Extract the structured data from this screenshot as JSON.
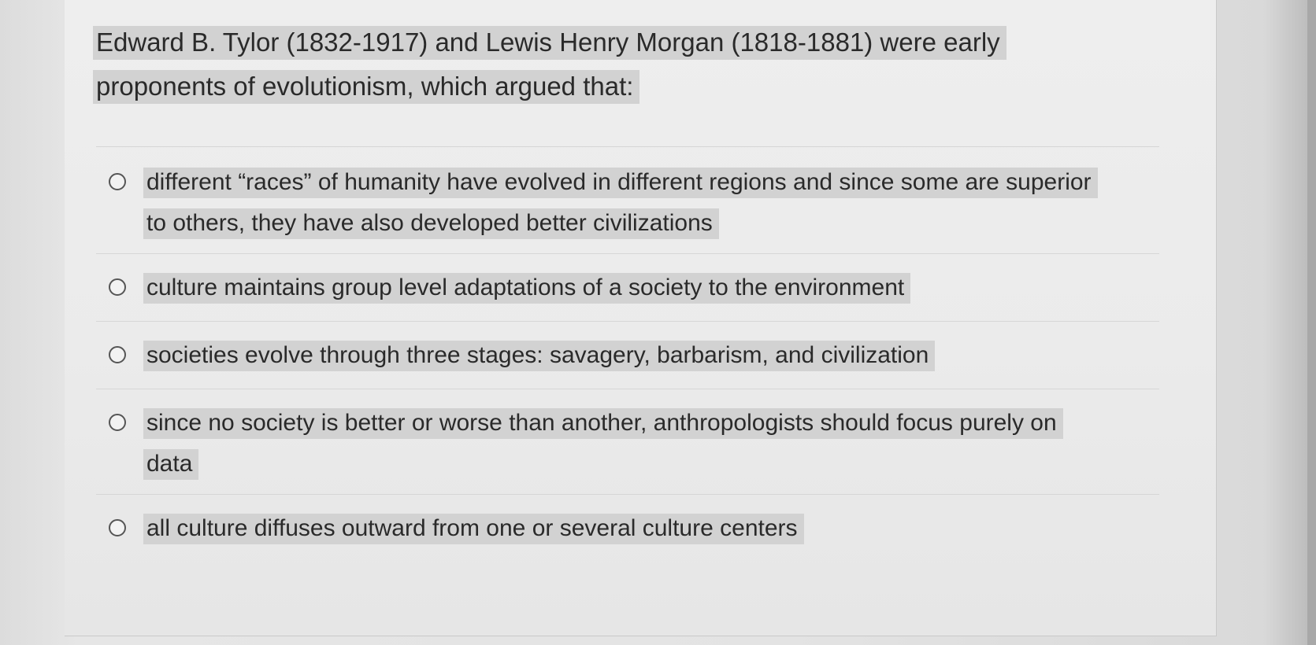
{
  "question": {
    "text": "Edward B. Tylor (1832-1917) and Lewis Henry Morgan (1818-1881) were early proponents of evolutionism, which argued that:"
  },
  "options": [
    {
      "label": "different “races” of humanity have evolved in different regions and since some are superior to others, they have also developed better civilizations",
      "selected": false
    },
    {
      "label": "culture maintains group level adaptations of a society to the environment",
      "selected": false
    },
    {
      "label": "societies evolve through three stages: savagery, barbarism, and civilization",
      "selected": false
    },
    {
      "label": "since no society is better or worse than another, anthropologists should focus purely on data",
      "selected": false
    },
    {
      "label": "all culture diffuses outward from one or several culture centers",
      "selected": false
    }
  ],
  "colors": {
    "highlight": "#d2d2d2",
    "text": "#2a2a2a",
    "panel": "#eeeeee"
  }
}
